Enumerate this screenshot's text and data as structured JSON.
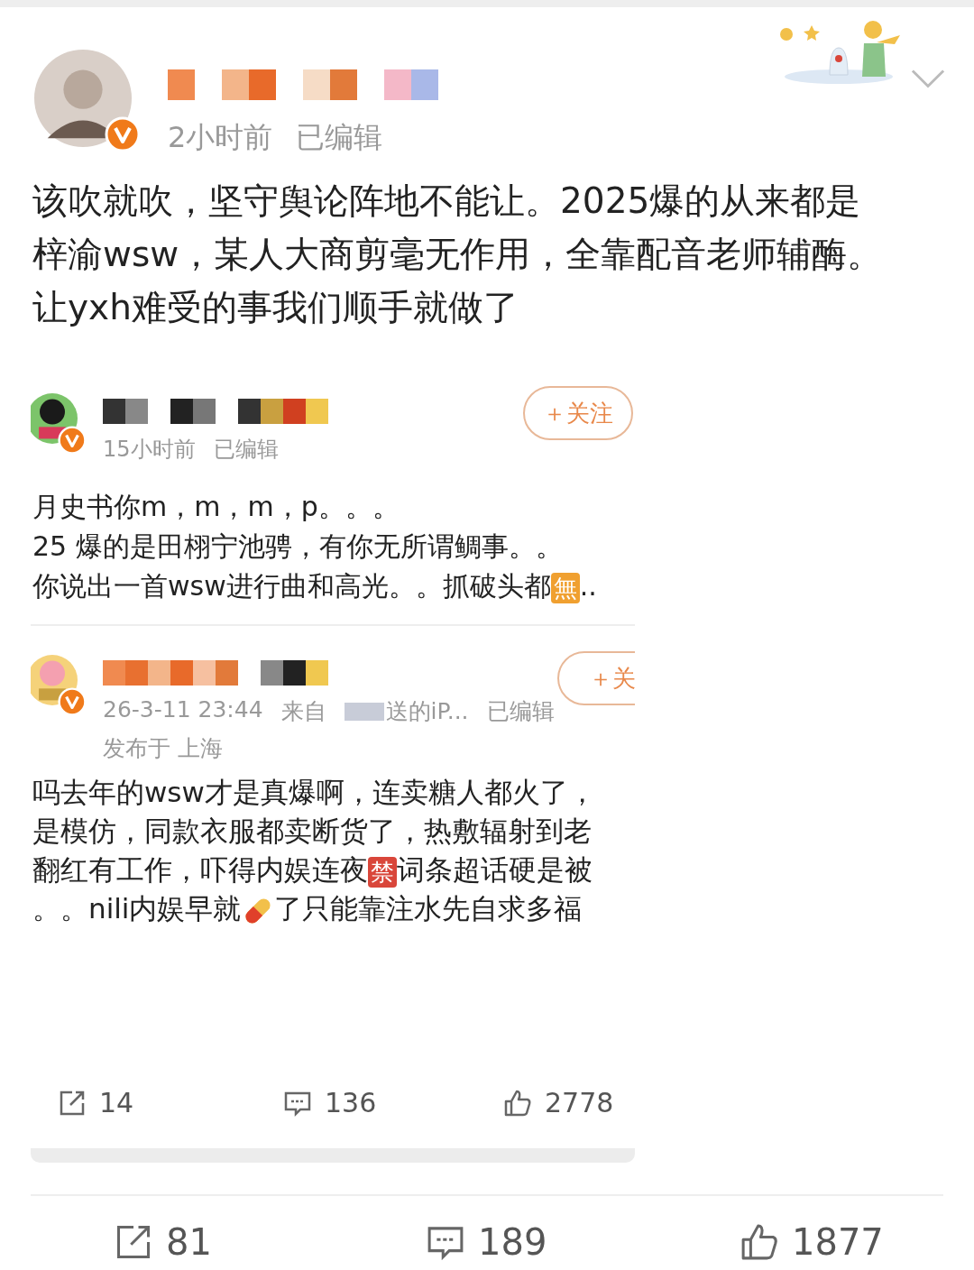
{
  "post": {
    "time": "2小时前",
    "edited": "已编辑",
    "text_lines": [
      "该吹就吹，坚守舆论阵地不能让。2025爆的从来都是",
      "梓渝wsw，某人大商剪毫无作用，全靠配音老师辅酶。",
      "让yxh难受的事我们顺手就做了"
    ]
  },
  "quoted": {
    "posts": [
      {
        "time": "15小时前",
        "edited": "已编辑",
        "follow": "＋关注",
        "lines": [
          [
            {
              "kind": "text",
              "text": "月史书你m，m，m，p。。。"
            }
          ],
          [
            {
              "kind": "text",
              "text": "25 爆的是田栩宁池骋，有你无所谓鲷事。。"
            }
          ],
          [
            {
              "kind": "text",
              "text": "你说出一首wsw进行曲和高光。。抓破头都"
            },
            {
              "kind": "emoji",
              "text": "無",
              "color": "#f0a030"
            },
            {
              "kind": "text",
              "text": ".."
            }
          ]
        ]
      },
      {
        "time": "26-3-11 23:44",
        "source_label": "来自",
        "source": "送的iP...",
        "edited": "已编辑",
        "location": "发布于 上海",
        "follow": "＋关",
        "lines": [
          [
            {
              "kind": "text",
              "text": "吗去年的wsw才是真爆啊，连卖糖人都火了，"
            }
          ],
          [
            {
              "kind": "text",
              "text": "是模仿，同款衣服都卖断货了，热敷辐射到老"
            }
          ],
          [
            {
              "kind": "text",
              "text": "翻红有工作，吓得内娱连夜"
            },
            {
              "kind": "emoji",
              "text": "禁",
              "color": "#d9463a"
            },
            {
              "kind": "text",
              "text": "词条超话硬是被"
            }
          ],
          [
            {
              "kind": "text",
              "text": "。。nili内娱早就"
            },
            {
              "kind": "pill"
            },
            {
              "kind": "text",
              "text": "了只能靠注水先自求多福"
            }
          ]
        ]
      }
    ],
    "stats": {
      "reposts": "14",
      "comments": "136",
      "likes": "2778"
    }
  },
  "stats": {
    "reposts": "81",
    "comments": "189",
    "likes": "1877"
  }
}
